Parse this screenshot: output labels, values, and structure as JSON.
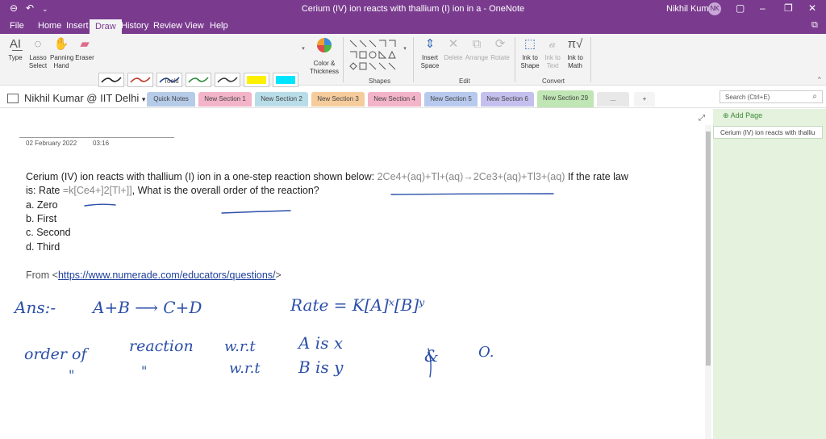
{
  "titlebar": {
    "title": "Cerium (IV) ion reacts with thallium (I) ion in a  -  OneNote",
    "user": "Nikhil Kumar",
    "initials": "NK"
  },
  "menu": [
    "File",
    "Home",
    "Insert",
    "Draw",
    "History",
    "Review",
    "View",
    "Help"
  ],
  "ribbon": {
    "type": "Type",
    "lasso": "Lasso Select",
    "panning": "Panning Hand",
    "eraser": "Eraser",
    "color_thickness": "Color & Thickness",
    "tools_group": "Tools",
    "shapes_group": "Shapes",
    "insert_space": "Insert Space",
    "delete": "Delete",
    "arrange": "Arrange",
    "rotate": "Rotate",
    "edit_group": "Edit",
    "ink_to_shape": "Ink to Shape",
    "ink_to_text": "Ink to Text",
    "ink_to_math": "Ink to Math",
    "convert_group": "Convert"
  },
  "pen_colors": [
    "#222222",
    "#c0392b",
    "#1a3f8f",
    "#2e8b3a",
    "#3a3a3a",
    "#ffef00",
    "#00e5ff",
    "#222222",
    "#c0392b",
    "#1a3f8f",
    "#2e8b3a",
    "#3a3a3a",
    "#e8e800",
    "#ff00d4"
  ],
  "notebook": "Nikhil Kumar @ IIT Delhi",
  "tabs": [
    {
      "label": "Quick Notes",
      "color": "#b5cbe8"
    },
    {
      "label": "New Section 1",
      "color": "#f3b3c9"
    },
    {
      "label": "New Section 2",
      "color": "#b8dde8"
    },
    {
      "label": "New Section 3",
      "color": "#f6cc9c"
    },
    {
      "label": "New Section 4",
      "color": "#f3b3c9"
    },
    {
      "label": "New Section 5",
      "color": "#b8c9ee"
    },
    {
      "label": "New Section 6",
      "color": "#c4c0ee"
    },
    {
      "label": "New Section 29",
      "color": "#bfe6b4"
    },
    {
      "label": "...",
      "color": "#e8e8e8"
    },
    {
      "label": "+",
      "color": "#f4f4f4"
    }
  ],
  "search_placeholder": "Search (Ctrl+E)",
  "add_page": "Add Page",
  "page_item": "Cerium (IV) ion reacts with thalliu",
  "note": {
    "date": "02 February 2022",
    "time": "03:16",
    "q1a": "Cerium (IV) ion reacts with thallium (I) ion in a one-step reaction shown below: ",
    "q1b": "2Ce4+(aq)+Tl+(aq)→2Ce3+(aq)+Tl3+(aq)",
    "q1c": " If the rate law",
    "q2a": "is: Rate ",
    "q2b": "=k[Ce4+]2[Tl+]]",
    "q2c": ", What is the overall order of the reaction?",
    "opt_a": "a. Zero",
    "opt_b": "b. First",
    "opt_c": "c. Second",
    "opt_d": "d. Third",
    "from": "From <",
    "url": "https://www.numerade.com/educators/questions/",
    "from_end": ">"
  },
  "handwriting": {
    "ans": "Ans:-",
    "reaction": "A+B ⟶ C+D",
    "rate": "Rate = K[A]ˣ[B]ʸ",
    "l2a": "order of",
    "l2b": "reaction",
    "l2c": "w.r.t",
    "l2d": "A is x",
    "l2e": "&",
    "l2f": "O.",
    "l3a": "\"",
    "l3b": "\"",
    "l3c": "w.r.t",
    "l3d": "B is y"
  }
}
